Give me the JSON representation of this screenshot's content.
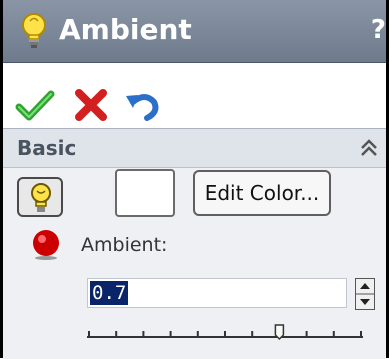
{
  "window": {
    "title": "Ambient",
    "help_label": "?"
  },
  "toolbar": {
    "icons": [
      "ok-check-icon",
      "cancel-x-icon",
      "undo-icon"
    ]
  },
  "section": {
    "title": "Basic",
    "collapse_icon": "double-chevron-up-icon"
  },
  "controls": {
    "light_icon": "lightbulb-icon",
    "swatch_color": "#ffffff",
    "edit_color_label": "Edit Color...",
    "ambient_indicator_color": "#cc0000",
    "ambient_label": "Ambient:",
    "ambient_value": "0.7",
    "slider_fraction": 0.7
  },
  "colors": {
    "titlebar": "#7a8696",
    "panel": "#eef0f3",
    "selection": "#0a246a",
    "ok_green": "#2fa52f",
    "cancel_red": "#d21f1f",
    "undo_blue": "#2c6fc9"
  }
}
